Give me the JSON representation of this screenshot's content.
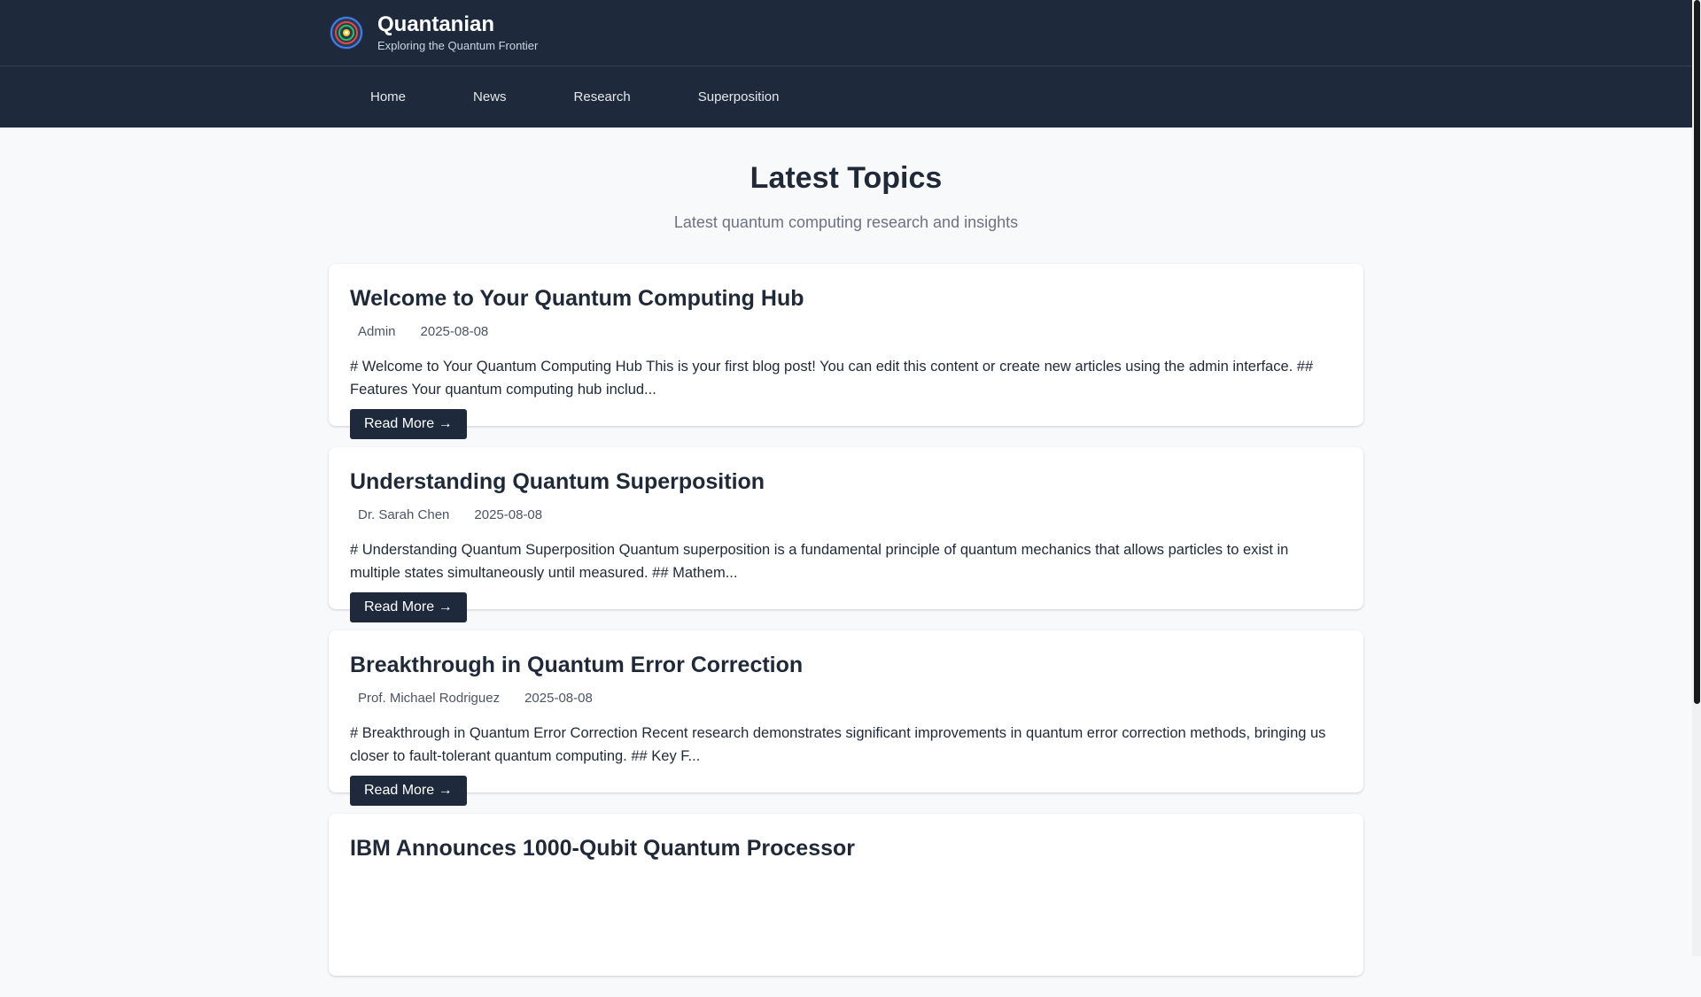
{
  "brand": {
    "title": "Quantanian",
    "subtitle": "Exploring the Quantum Frontier",
    "logo_icon": "atom-icon"
  },
  "nav": {
    "items": [
      {
        "label": "Home"
      },
      {
        "label": "News"
      },
      {
        "label": "Research"
      },
      {
        "label": "Superposition"
      }
    ]
  },
  "main": {
    "title": "Latest Topics",
    "subtitle": "Latest quantum computing research and insights"
  },
  "posts": [
    {
      "title": "Welcome to Your Quantum Computing Hub",
      "author": "Admin",
      "date": "2025-08-08",
      "excerpt": "# Welcome to Your Quantum Computing Hub This is your first blog post! You can edit this content or create new articles using the admin interface. ## Features Your quantum computing hub includ...",
      "read_more": "Read More →"
    },
    {
      "title": "Understanding Quantum Superposition",
      "author": "Dr. Sarah Chen",
      "date": "2025-08-08",
      "excerpt": "# Understanding Quantum Superposition Quantum superposition is a fundamental principle of quantum mechanics that allows particles to exist in multiple states simultaneously until measured. ## Mathem...",
      "read_more": "Read More →"
    },
    {
      "title": "Breakthrough in Quantum Error Correction",
      "author": "Prof. Michael Rodriguez",
      "date": "2025-08-08",
      "excerpt": "# Breakthrough in Quantum Error Correction Recent research demonstrates significant improvements in quantum error correction methods, bringing us closer to fault-tolerant quantum computing. ## Key F...",
      "read_more": "Read More →"
    },
    {
      "title": "IBM Announces 1000-Qubit Quantum Processor",
      "author": "",
      "date": "",
      "excerpt": "",
      "read_more": ""
    }
  ],
  "colors": {
    "header_bg": "#1e293b",
    "page_bg": "#f8f9fb",
    "button_bg": "#1e293b",
    "text_primary": "#1f2937",
    "text_muted": "#6b7280"
  }
}
